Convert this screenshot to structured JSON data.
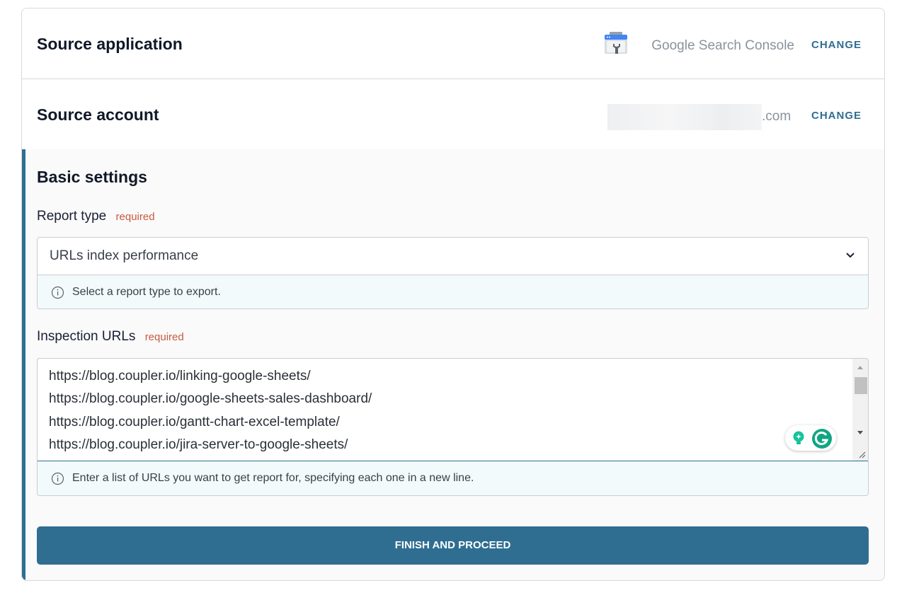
{
  "source_application": {
    "title": "Source application",
    "app_name": "Google Search Console",
    "app_icon": "google-search-console-icon",
    "change_label": "CHANGE"
  },
  "source_account": {
    "title": "Source account",
    "account_domain": ".com",
    "change_label": "CHANGE"
  },
  "basic_settings": {
    "title": "Basic settings",
    "report_type": {
      "label": "Report type",
      "required_label": "required",
      "value": "URLs index performance",
      "hint": "Select a report type to export."
    },
    "inspection_urls": {
      "label": "Inspection URLs",
      "required_label": "required",
      "lines": [
        "https://blog.coupler.io/linking-google-sheets/",
        "https://blog.coupler.io/google-sheets-sales-dashboard/",
        "https://blog.coupler.io/gantt-chart-excel-template/",
        "https://blog.coupler.io/jira-server-to-google-sheets/"
      ],
      "hint": "Enter a list of URLs you want to get report for, specifying each one in a new line."
    },
    "proceed_label": "FINISH AND PROCEED"
  },
  "colors": {
    "accent": "#2f6e91",
    "required": "#c8593f",
    "hint_bg": "#f2fafb"
  }
}
